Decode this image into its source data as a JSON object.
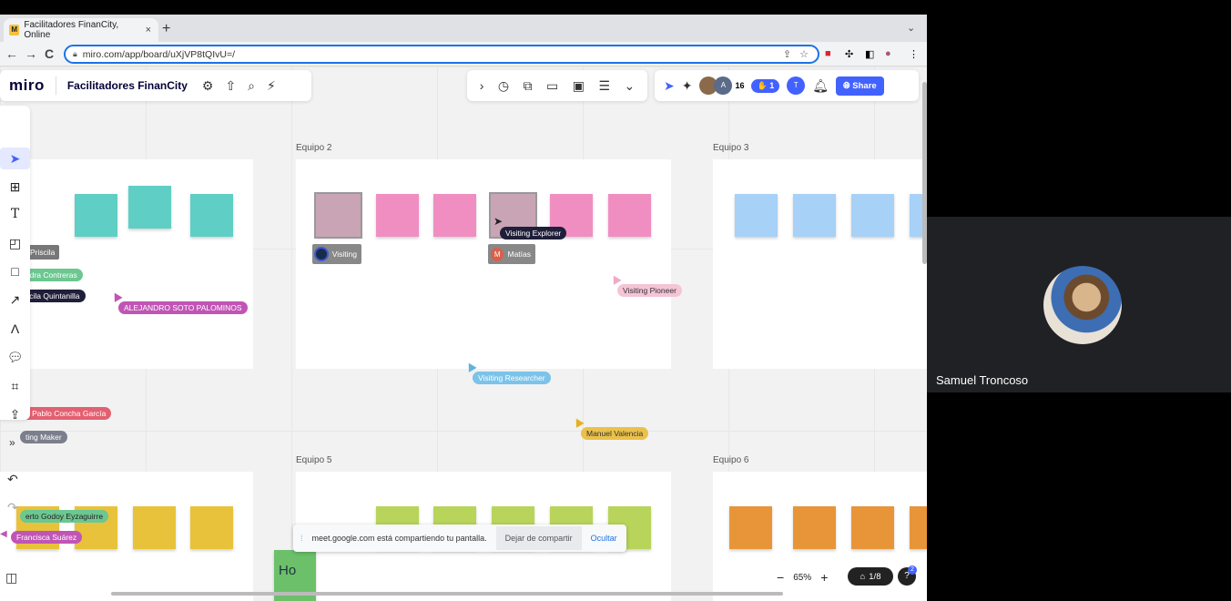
{
  "browser": {
    "tab_title": "Facilitadores FinanCity, Online",
    "tab_close": "×",
    "new_tab": "+",
    "url": "miro.com/app/board/uXjVP8tQIvU=/",
    "back": "←",
    "forward": "→",
    "reload": "C"
  },
  "miro": {
    "logo": "miro",
    "board_name": "Facilitadores FinanCity",
    "participants_count": "16",
    "hands_count": "1",
    "share_label": "Share",
    "avatar_a": "A",
    "avatar_t": "T",
    "zoom_level": "65%",
    "zoom_minus": "−",
    "zoom_plus": "+",
    "pages": "1/8",
    "notification_count": "2"
  },
  "frames": [
    {
      "title": "Equipo 2"
    },
    {
      "title": "Equipo 3"
    },
    {
      "title": "Equipo 5"
    },
    {
      "title": "Equipo 6"
    }
  ],
  "cursors": {
    "priscila": "Priscila",
    "contreras": "ndra Contreras",
    "quintanilla": "scila Quintanilla",
    "alejandro": "ALEJANDRO SOTO PALOMINOS",
    "visiting": "Visiting",
    "visiting_explorer": "Visiting Explorer",
    "matias": "Matías",
    "matias_initial": "M",
    "visiting_pioneer": "Visiting Pioneer",
    "visiting_researcher": "Visiting Researcher",
    "concha": "n Pablo Concha García",
    "maker": "ting Maker",
    "manuel": "Manuel Valencia",
    "godoy": "erto Godoy Eyzaguirre",
    "francisca": "Francisca Suárez",
    "green_sticky_text": "Ho"
  },
  "meet_share": {
    "message": "meet.google.com está compartiendo tu pantalla.",
    "stop_button": "Dejar de compartir",
    "hide_button": "Ocultar"
  },
  "video": {
    "participant_name": "Samuel Troncoso"
  },
  "colors": {
    "teal": "#5fcfc6",
    "pink": "#f08ec1",
    "blue": "#a7d1f7",
    "yellow": "#e8c23a",
    "lime": "#b9d45a",
    "orange": "#e8953a",
    "miro_blue": "#4262ff"
  }
}
